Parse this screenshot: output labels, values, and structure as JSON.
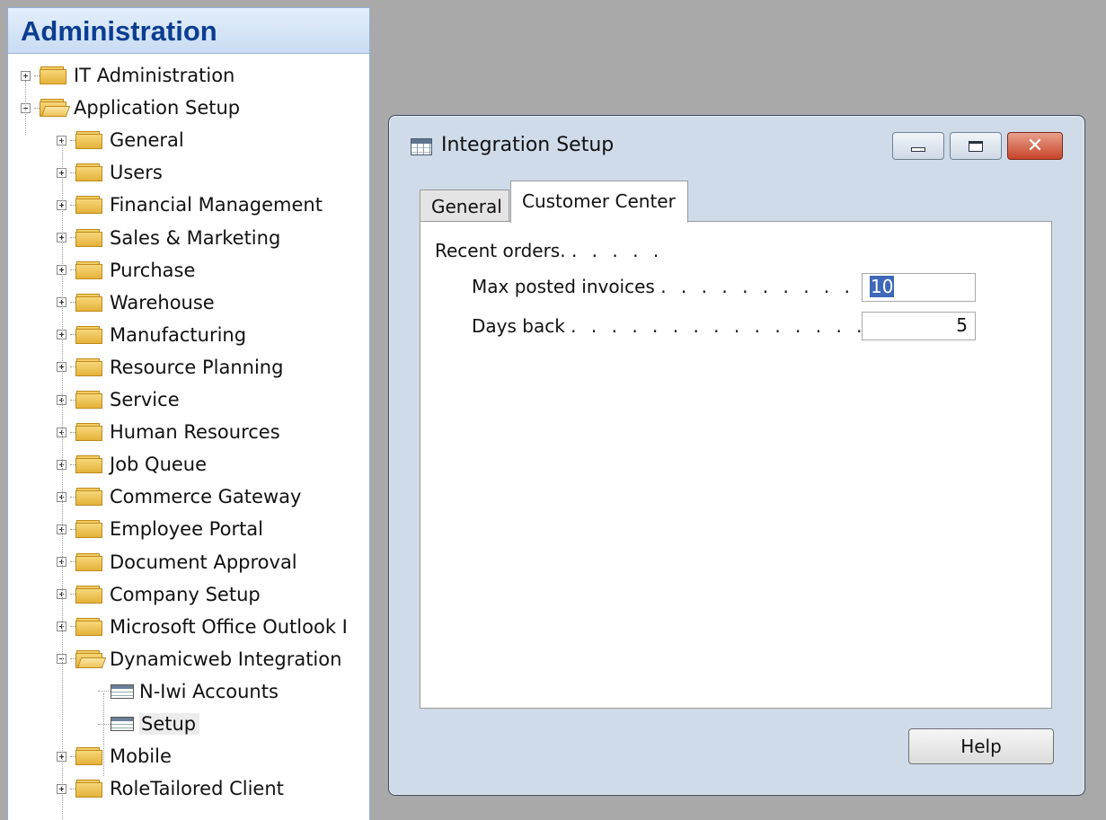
{
  "nav": {
    "header": "Administration",
    "tree": [
      {
        "label": "IT Administration",
        "level": 0,
        "kind": "folder",
        "expander": "plus"
      },
      {
        "label": "Application Setup",
        "level": 0,
        "kind": "folder-open",
        "expander": "minus"
      },
      {
        "label": "General",
        "level": 1,
        "kind": "folder",
        "expander": "plus"
      },
      {
        "label": "Users",
        "level": 1,
        "kind": "folder",
        "expander": "plus"
      },
      {
        "label": "Financial Management",
        "level": 1,
        "kind": "folder",
        "expander": "plus"
      },
      {
        "label": "Sales & Marketing",
        "level": 1,
        "kind": "folder",
        "expander": "plus"
      },
      {
        "label": "Purchase",
        "level": 1,
        "kind": "folder",
        "expander": "plus"
      },
      {
        "label": "Warehouse",
        "level": 1,
        "kind": "folder",
        "expander": "plus"
      },
      {
        "label": "Manufacturing",
        "level": 1,
        "kind": "folder",
        "expander": "plus"
      },
      {
        "label": "Resource Planning",
        "level": 1,
        "kind": "folder",
        "expander": "plus"
      },
      {
        "label": "Service",
        "level": 1,
        "kind": "folder",
        "expander": "plus"
      },
      {
        "label": "Human Resources",
        "level": 1,
        "kind": "folder",
        "expander": "plus"
      },
      {
        "label": "Job Queue",
        "level": 1,
        "kind": "folder",
        "expander": "plus"
      },
      {
        "label": "Commerce Gateway",
        "level": 1,
        "kind": "folder",
        "expander": "plus"
      },
      {
        "label": "Employee Portal",
        "level": 1,
        "kind": "folder",
        "expander": "plus"
      },
      {
        "label": "Document Approval",
        "level": 1,
        "kind": "folder",
        "expander": "plus"
      },
      {
        "label": "Company Setup",
        "level": 1,
        "kind": "folder",
        "expander": "plus"
      },
      {
        "label": "Microsoft Office Outlook I",
        "level": 1,
        "kind": "folder",
        "expander": "plus"
      },
      {
        "label": "Dynamicweb Integration",
        "level": 1,
        "kind": "folder-open",
        "expander": "minus"
      },
      {
        "label": "N-Iwi Accounts",
        "level": 2,
        "kind": "table",
        "expander": "none"
      },
      {
        "label": "Setup",
        "level": 2,
        "kind": "table",
        "expander": "none",
        "selected": true
      },
      {
        "label": "Mobile",
        "level": 1,
        "kind": "folder",
        "expander": "plus"
      },
      {
        "label": "RoleTailored Client",
        "level": 1,
        "kind": "folder",
        "expander": "plus"
      }
    ]
  },
  "dialog": {
    "title": "Integration Setup",
    "icon": "table-form-icon",
    "controls": {
      "minimize": "",
      "maximize": "",
      "close": "✕"
    },
    "tabs": [
      {
        "label": "General",
        "active": false
      },
      {
        "label": "Customer Center",
        "active": true
      }
    ],
    "group_label": "Recent orders.",
    "group_dots": ". . . . .",
    "fields": [
      {
        "label": "Max posted invoices",
        "dots": ". . . . . . . . . . . .",
        "value": "10",
        "selected": true
      },
      {
        "label": "Days back",
        "dots": ". . . . . . . . . . . . . . . . . . .",
        "value": "5",
        "selected": false
      }
    ],
    "help_label": "Help"
  },
  "colors": {
    "nav_header_text": "#0b3d91",
    "desktop": "#a9a9a9",
    "close_button": "#c8442a",
    "selection": "#3e68b8"
  }
}
